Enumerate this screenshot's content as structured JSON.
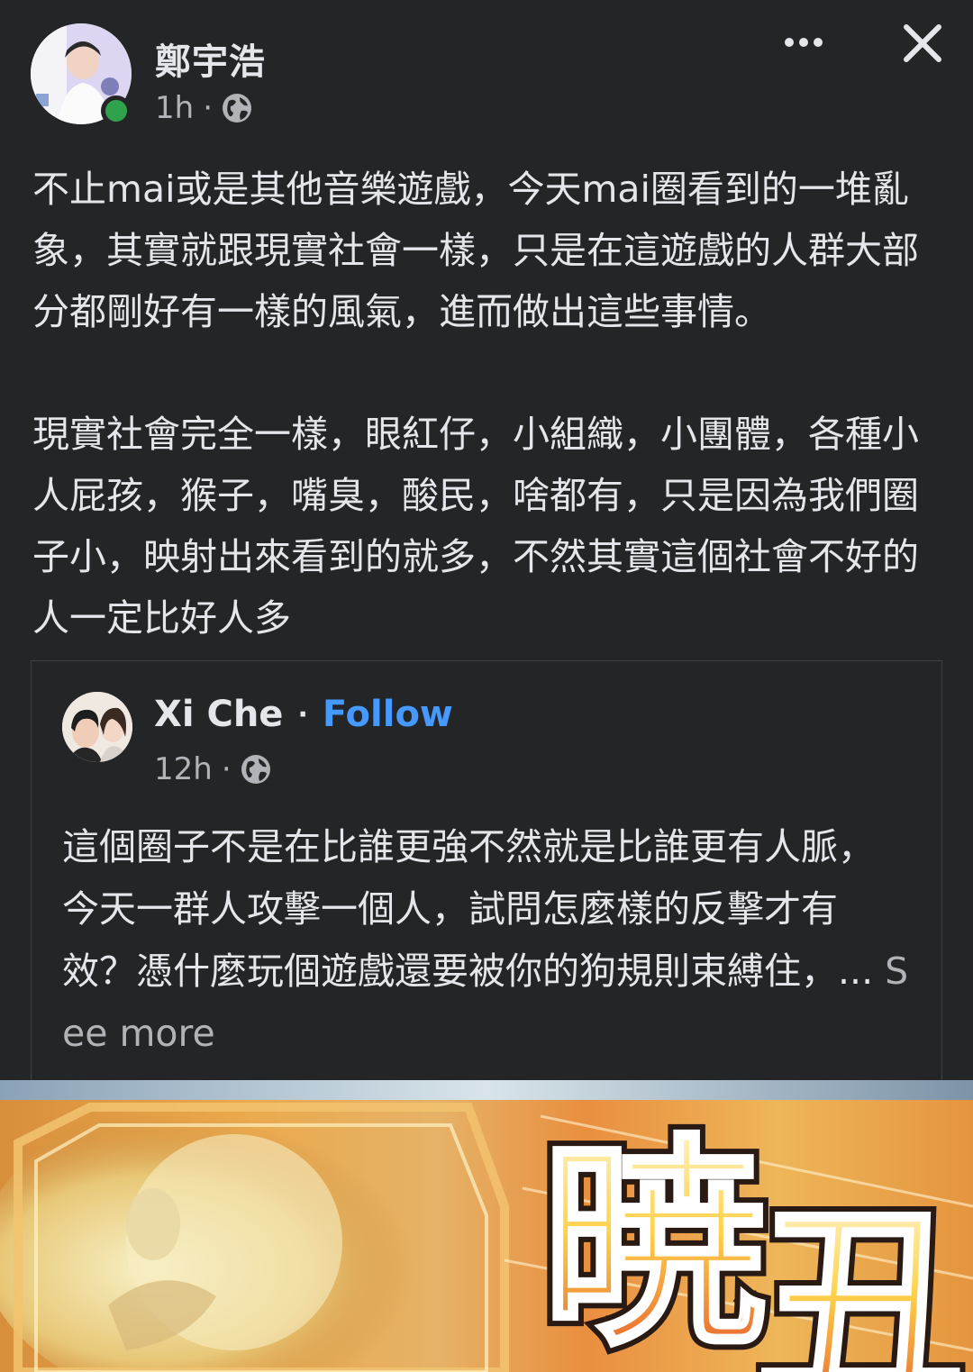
{
  "post": {
    "author": "鄭宇浩",
    "time": "1h",
    "separator": "·",
    "text": "不止mai或是其他音樂遊戲，今天mai圈看到的一堆亂象，其實就跟現實社會一樣，只是在這遊戲的人群大部分都剛好有一樣的風氣，進而做出這些事情。\n\n現實社會完全一樣，眼紅仔，小組織，小團體，各種小人屁孩，猴子，嘴臭，酸民，啥都有，只是因為我們圈子小，映射出來看到的就多，不然其實這個社會不好的人一定比好人多"
  },
  "shared": {
    "author": "Xi Che",
    "dot": "·",
    "follow_label": "Follow",
    "time": "12h",
    "separator": "·",
    "text": "這個圈子不是在比誰更強不然就是比誰更有人脈，今天一群人攻擊一個人，試問怎麼樣的反擊才有效？憑什麼玩個遊戲還要被你的狗規則束縛住，",
    "ellipsis": "... ",
    "see_more_label": "See more"
  },
  "colors": {
    "background": "#242526",
    "text": "#e4e6eb",
    "secondary": "#b0b3b8",
    "link": "#4599ff",
    "online": "#31a24c"
  },
  "icons": {
    "privacy": "globe-icon",
    "more": "more-dots-icon",
    "close": "close-icon"
  }
}
